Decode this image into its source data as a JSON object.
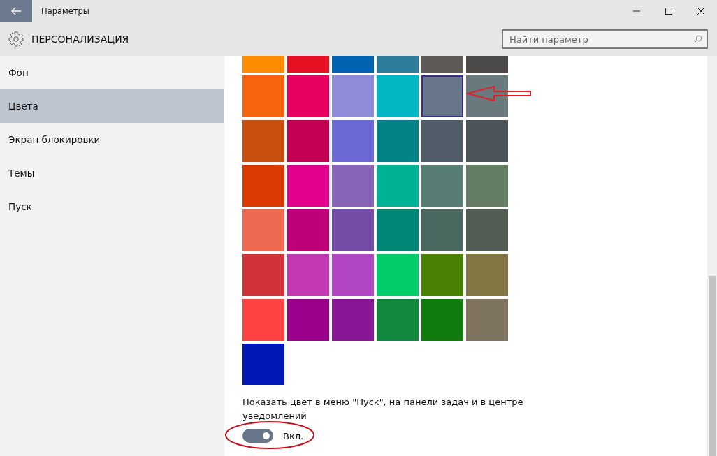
{
  "window": {
    "title": "Параметры"
  },
  "header": {
    "title": "ПЕРСОНАЛИЗАЦИЯ"
  },
  "search": {
    "placeholder": "Найти параметр"
  },
  "sidebar": {
    "items": [
      {
        "label": "Фон",
        "selected": false
      },
      {
        "label": "Цвета",
        "selected": true
      },
      {
        "label": "Экран блокировки",
        "selected": false
      },
      {
        "label": "Темы",
        "selected": false
      },
      {
        "label": "Пуск",
        "selected": false
      }
    ]
  },
  "swatches": [
    {
      "color": "#ff8c00",
      "selected": false
    },
    {
      "color": "#e81123",
      "selected": false
    },
    {
      "color": "#0063b1",
      "selected": false
    },
    {
      "color": "#2d7d9a",
      "selected": false
    },
    {
      "color": "#5d5a58",
      "selected": false
    },
    {
      "color": "#4c4a48",
      "selected": false
    },
    {
      "color": "#f7630c",
      "selected": false
    },
    {
      "color": "#ea005e",
      "selected": false
    },
    {
      "color": "#8e8cd8",
      "selected": false
    },
    {
      "color": "#00b7c3",
      "selected": false
    },
    {
      "color": "#68768a",
      "selected": true
    },
    {
      "color": "#69797e",
      "selected": false
    },
    {
      "color": "#ca5010",
      "selected": false
    },
    {
      "color": "#c30052",
      "selected": false
    },
    {
      "color": "#6b69d6",
      "selected": false
    },
    {
      "color": "#038387",
      "selected": false
    },
    {
      "color": "#515c6b",
      "selected": false
    },
    {
      "color": "#4a5459",
      "selected": false
    },
    {
      "color": "#da3b01",
      "selected": false
    },
    {
      "color": "#e3008c",
      "selected": false
    },
    {
      "color": "#8764b8",
      "selected": false
    },
    {
      "color": "#00b294",
      "selected": false
    },
    {
      "color": "#567c73",
      "selected": false
    },
    {
      "color": "#647c64",
      "selected": false
    },
    {
      "color": "#ef6950",
      "selected": false
    },
    {
      "color": "#bf0077",
      "selected": false
    },
    {
      "color": "#744da9",
      "selected": false
    },
    {
      "color": "#018574",
      "selected": false
    },
    {
      "color": "#486860",
      "selected": false
    },
    {
      "color": "#525e54",
      "selected": false
    },
    {
      "color": "#d13438",
      "selected": false
    },
    {
      "color": "#c239b3",
      "selected": false
    },
    {
      "color": "#b146c2",
      "selected": false
    },
    {
      "color": "#00cc6a",
      "selected": false
    },
    {
      "color": "#498205",
      "selected": false
    },
    {
      "color": "#847545",
      "selected": false
    },
    {
      "color": "#ff4343",
      "selected": false
    },
    {
      "color": "#9a0089",
      "selected": false
    },
    {
      "color": "#881798",
      "selected": false
    },
    {
      "color": "#10893e",
      "selected": false
    },
    {
      "color": "#107c10",
      "selected": false
    },
    {
      "color": "#7e735f",
      "selected": false
    },
    {
      "color": "#0018b4",
      "selected": false
    }
  ],
  "accent_toggle": {
    "label": "Показать цвет в меню \"Пуск\", на панели задач и в центре уведомлений",
    "on": true,
    "state_text": "Вкл."
  }
}
